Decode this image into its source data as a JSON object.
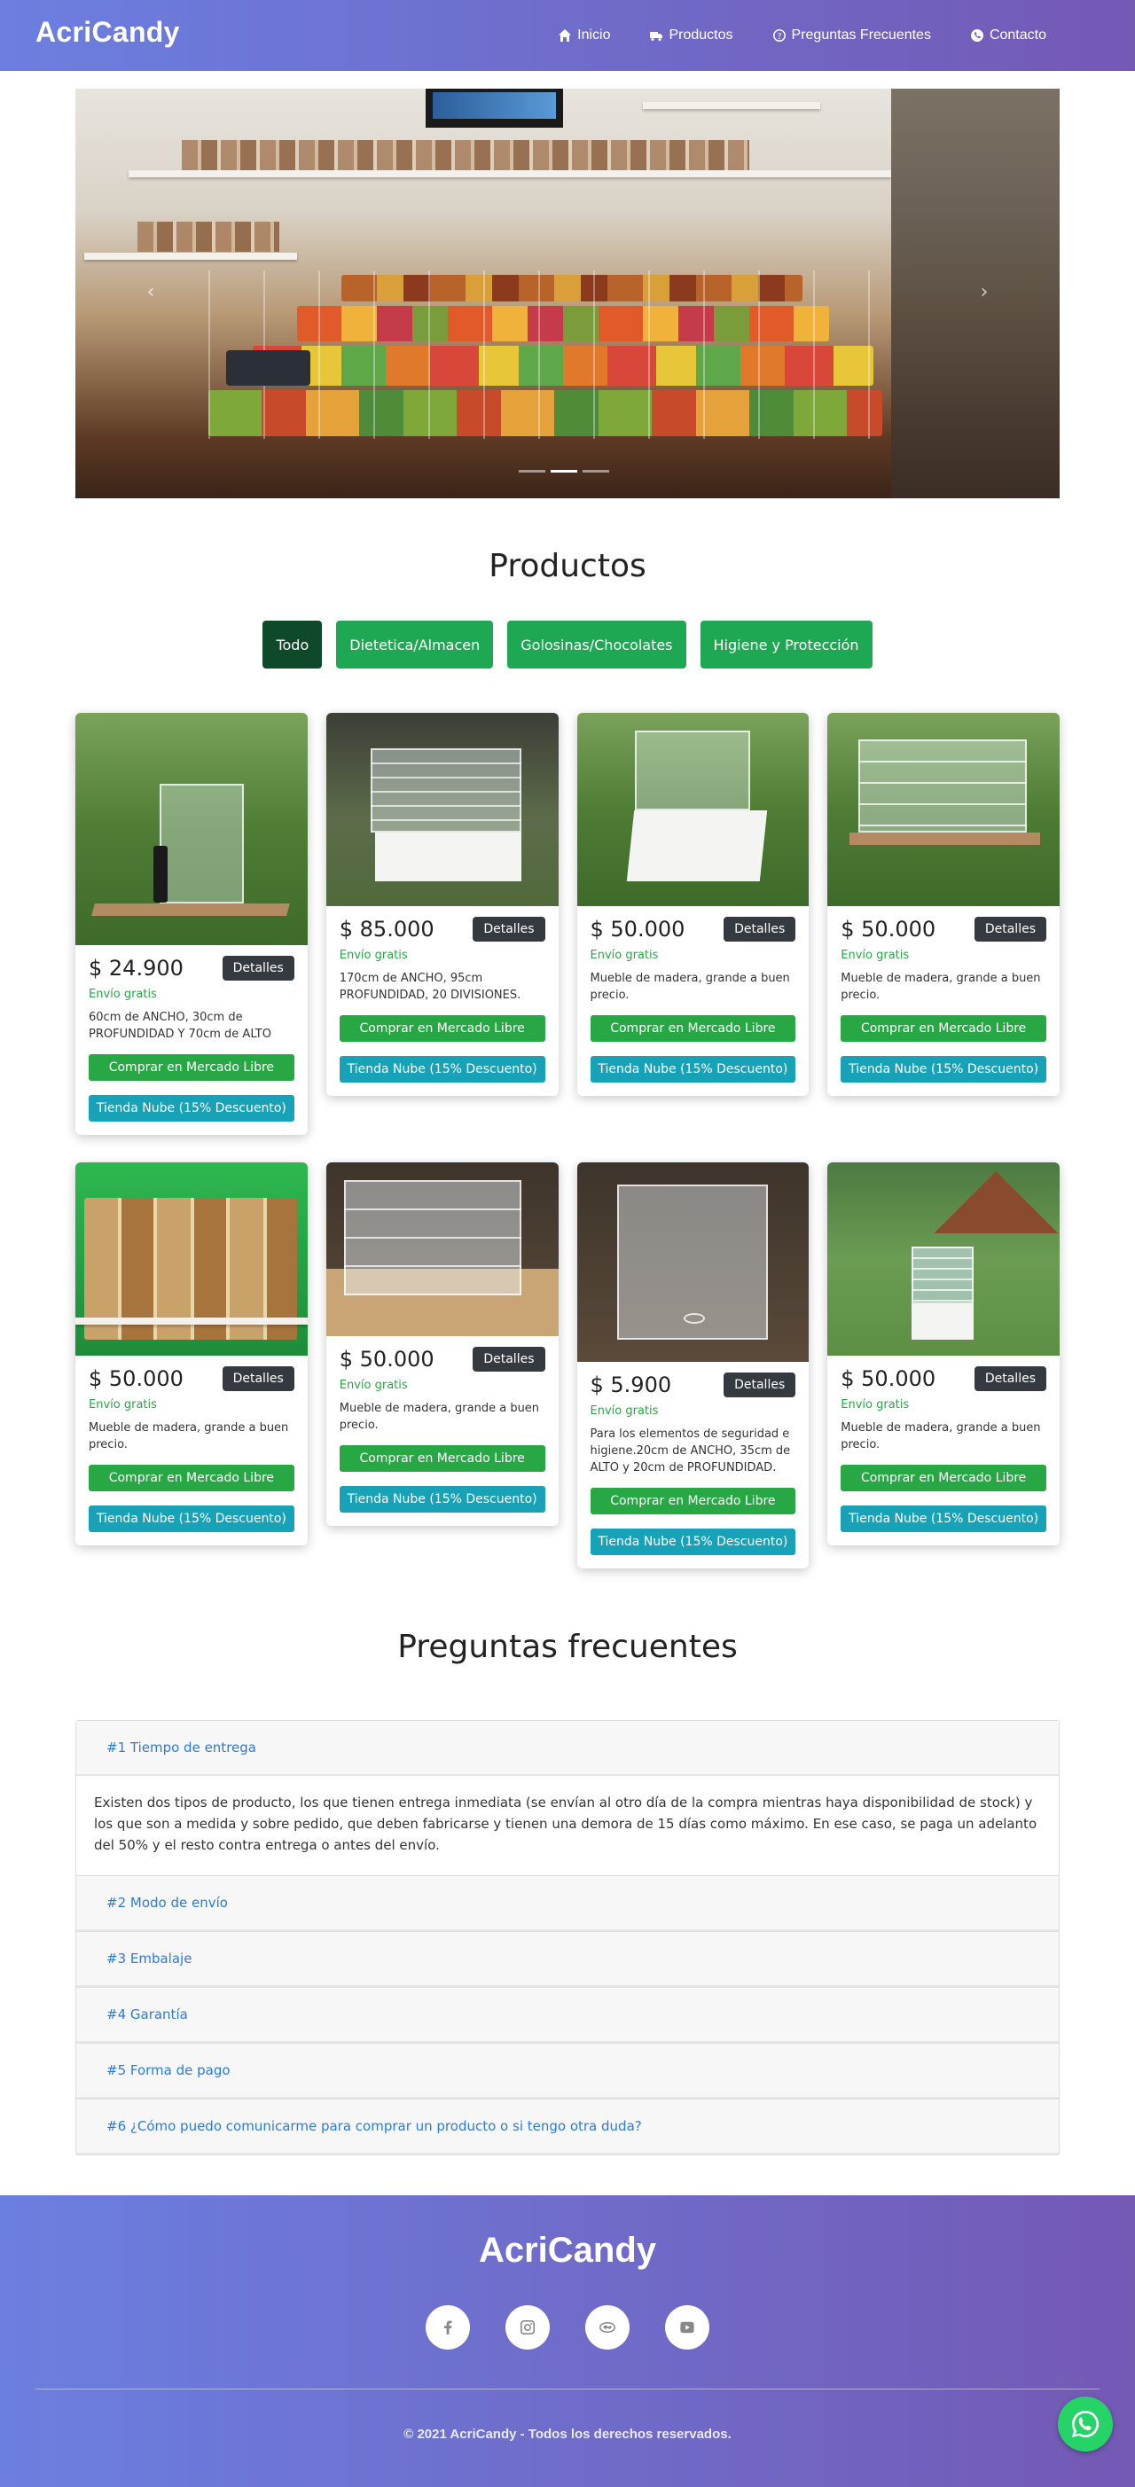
{
  "navbar": {
    "brand": "AcriCandy",
    "links": [
      {
        "label": "Inicio",
        "icon": "home-icon"
      },
      {
        "label": "Productos",
        "icon": "truck-icon"
      },
      {
        "label": "Preguntas Frecuentes",
        "icon": "question-circle-icon"
      },
      {
        "label": "Contacto",
        "icon": "phone-icon"
      }
    ]
  },
  "carousel": {
    "prev_symbol": "‹",
    "next_symbol": "›",
    "slides": 3,
    "active_slide": 1
  },
  "products": {
    "title": "Productos",
    "filters": [
      "Todo",
      "Dietetica/Almacen",
      "Golosinas/Chocolates",
      "Higiene y Protección"
    ],
    "active_filter": "Todo",
    "details_label": "Detalles",
    "shipping_label": "Envío gratis",
    "ml_label": "Comprar en Mercado Libre",
    "tn_label": "Tienda Nube (15% Descuento)",
    "items": [
      {
        "price": "$ 24.900",
        "description": "60cm de ANCHO, 30cm de PROFUNDIDAD Y 70cm de ALTO"
      },
      {
        "price": "$ 85.000",
        "description": "170cm de ANCHO, 95cm PROFUNDIDAD, 20 DIVISIONES."
      },
      {
        "price": "$ 50.000",
        "description": "Mueble de madera, grande a buen precio."
      },
      {
        "price": "$ 50.000",
        "description": "Mueble de madera, grande a buen precio."
      },
      {
        "price": "$ 50.000",
        "description": "Mueble de madera, grande a buen precio."
      },
      {
        "price": "$ 50.000",
        "description": "Mueble de madera, grande a buen precio."
      },
      {
        "price": "$ 5.900",
        "description": "Para los elementos de seguridad e higiene.20cm de ANCHO, 35cm de ALTO y 20cm de PROFUNDIDAD."
      },
      {
        "price": "$ 50.000",
        "description": "Mueble de madera, grande a buen precio."
      }
    ]
  },
  "faq": {
    "title": "Preguntas frecuentes",
    "items": [
      {
        "question": "#1 Tiempo de entrega",
        "answer": "Existen dos tipos de producto, los que tienen entrega inmediata (se envían al otro día de la compra mientras haya disponibilidad de stock) y los que son a medida y sobre pedido, que deben fabricarse y tienen una demora de 15 días como máximo. En ese caso, se paga un adelanto del 50% y el resto contra entrega o antes del envío."
      },
      {
        "question": "#2 Modo de envío"
      },
      {
        "question": "#3 Embalaje"
      },
      {
        "question": "#4 Garantía"
      },
      {
        "question": "#5 Forma de pago"
      },
      {
        "question": "#6 ¿Cómo puedo comunicarme para comprar un producto o si tengo otra duda?"
      }
    ]
  },
  "footer": {
    "brand": "AcriCandy",
    "socials": [
      "facebook-icon",
      "instagram-icon",
      "mercadolibre-icon",
      "youtube-icon"
    ],
    "copyright": "© 2021 AcriCandy - Todos los derechos reservados."
  },
  "colors": {
    "gradient_start": "#6b7fe0",
    "gradient_end": "#7459b5",
    "green": "#28a745",
    "teal": "#17a2b8",
    "dark": "#343a40",
    "link_blue": "#2a7ae2",
    "whatsapp": "#25d366"
  }
}
